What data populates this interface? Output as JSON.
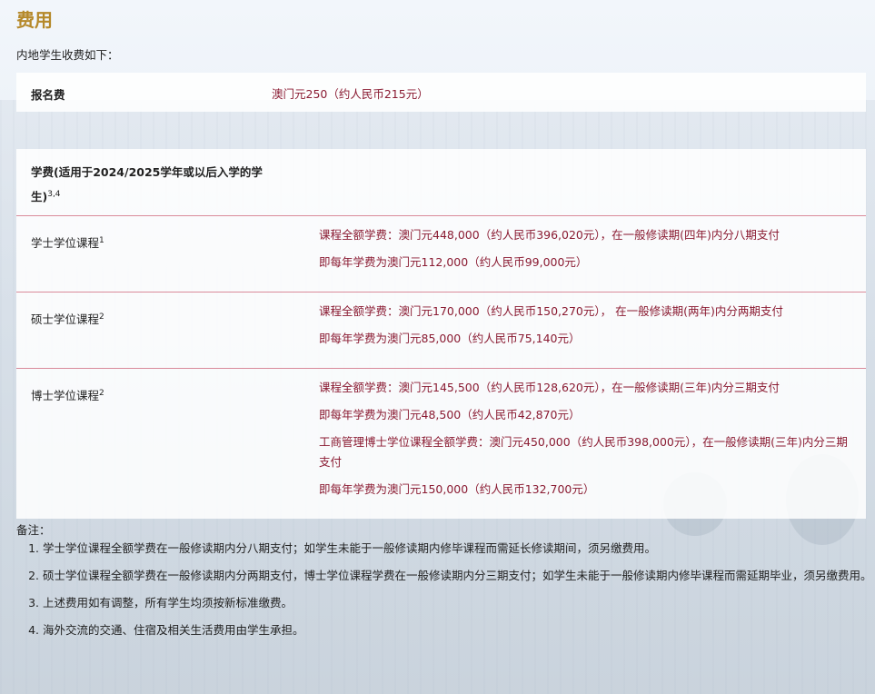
{
  "page": {
    "title": "费用",
    "intro": "内地学生收费如下："
  },
  "application_fee": {
    "label": "报名费",
    "value": "澳门元250（约人民币215元）"
  },
  "tuition": {
    "header": "学费(适用于2024/2025学年或以后入学的学生)",
    "header_sup": "3,4",
    "programs": [
      {
        "name": "学士学位课程",
        "sup": "1",
        "fees": [
          "课程全额学费：澳门元448,000（约人民币396,020元），在一般修读期(四年)内分八期支付",
          "即每年学费为澳门元112,000（约人民币99,000元）"
        ]
      },
      {
        "name": "硕士学位课程",
        "sup": "2",
        "fees": [
          "课程全额学费：澳门元170,000（约人民币150,270元）， 在一般修读期(两年)内分两期支付",
          "即每年学费为澳门元85,000（约人民币75,140元）"
        ]
      },
      {
        "name": "博士学位课程",
        "sup": "2",
        "fees": [
          "课程全额学费：澳门元145,500（约人民币128,620元），在一般修读期(三年)内分三期支付",
          "即每年学费为澳门元48,500（约人民币42,870元）",
          "工商管理博士学位课程全额学费：澳门元450,000（约人民币398,000元），在一般修读期(三年)内分三期支付",
          "即每年学费为澳门元150,000（约人民币132,700元）"
        ]
      }
    ]
  },
  "notes": {
    "title": "备注：",
    "items": [
      "学士学位课程全额学费在一般修读期内分八期支付；如学生未能于一般修读期内修毕课程而需延长修读期间，须另缴费用。",
      "硕士学位课程全额学费在一般修读期内分两期支付，博士学位课程学费在一般修读期内分三期支付；如学生未能于一般修读期内修毕课程而需延期毕业，须另缴费用。",
      "上述费用如有调整，所有学生均须按新标准缴费。",
      "海外交流的交通、住宿及相关生活费用由学生承担。"
    ]
  },
  "colors": {
    "title": "#b5892a",
    "fee_text": "#8a1b32",
    "separator": "#d98a9a"
  }
}
